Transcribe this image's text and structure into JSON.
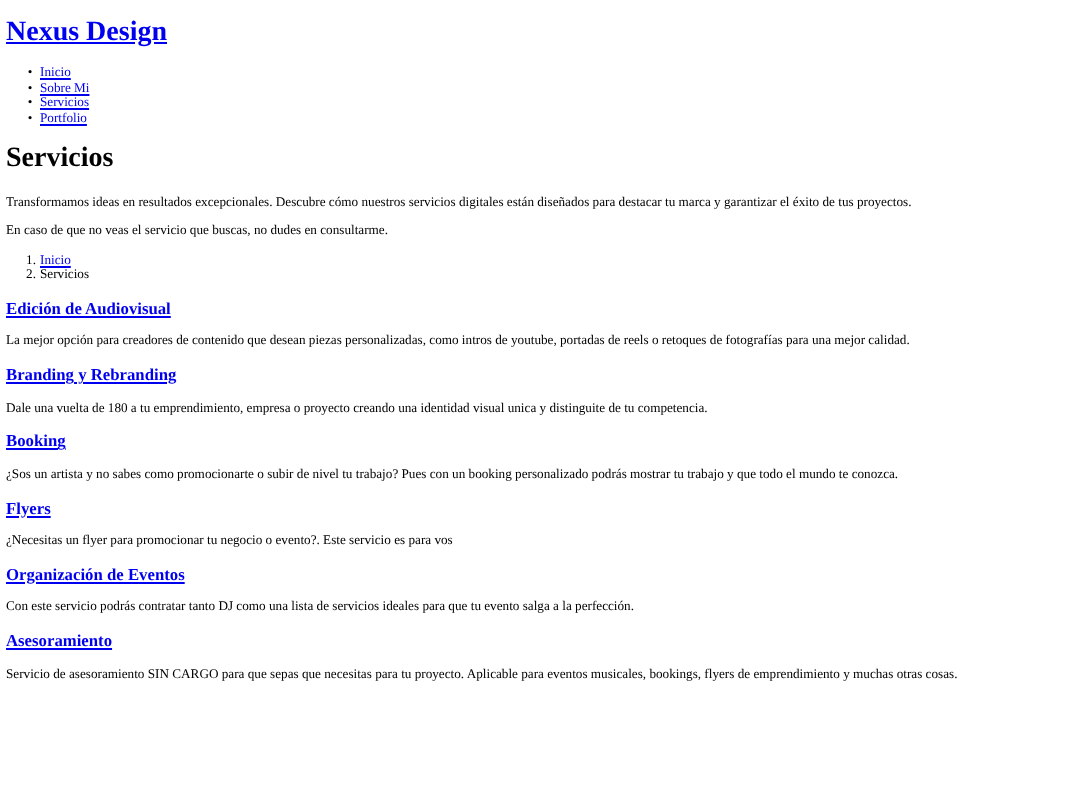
{
  "site_title": "Nexus Design",
  "nav": [
    {
      "bullet": "•",
      "label": "Inicio"
    },
    {
      "bullet": "•",
      "label": "Sobre Mi"
    },
    {
      "bullet": "•",
      "label": "Servicios"
    },
    {
      "bullet": "•",
      "label": "Portfolio"
    }
  ],
  "page_title": "Servicios",
  "intro": [
    "Transformamos ideas en resultados excepcionales. Descubre cómo nuestros servicios digitales están diseñados para destacar tu marca y garantizar el éxito de tus proyectos.",
    "En caso de que no veas el servicio que buscas, no dudes en consultarme."
  ],
  "breadcrumb": [
    {
      "number": "1.",
      "label": "Inicio",
      "current": false
    },
    {
      "number": "2.",
      "label": "Servicios",
      "current": true
    }
  ],
  "services": [
    {
      "title": "Edición de Audiovisual",
      "description": "La mejor opción para creadores de contenido que desean piezas personalizadas, como intros de youtube, portadas de reels o retoques de fotografías para una mejor calidad."
    },
    {
      "title": "Branding y Rebranding",
      "description": "Dale una vuelta de 180 a tu emprendimiento, empresa o proyecto creando una identidad visual unica y distinguite de tu competencia."
    },
    {
      "title": "Booking",
      "description": "¿Sos un artista y no sabes como promocionarte o subir de nivel tu trabajo? Pues con un booking personalizado podrás mostrar tu trabajo y que todo el mundo te conozca."
    },
    {
      "title": "Flyers",
      "description": "¿Necesitas un flyer para promocionar tu negocio o evento?. Este servicio es para vos"
    },
    {
      "title": "Organización de Eventos",
      "description": "Con este servicio podrás contratar tanto DJ como una lista de servicios ideales para que tu evento salga a la perfección."
    },
    {
      "title": "Asesoramiento",
      "description": "Servicio de asesoramiento SIN CARGO para que sepas que necesitas para tu proyecto. Aplicable para eventos musicales, bookings, flyers de emprendimiento y muchas otras cosas."
    }
  ]
}
